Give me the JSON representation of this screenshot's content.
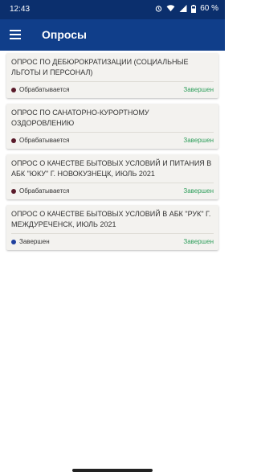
{
  "status_bar": {
    "time": "12:43",
    "battery": "60 %"
  },
  "app_bar": {
    "title": "Опросы",
    "menu_icon": "hamburger-menu-icon"
  },
  "colors": {
    "app_bar": "#103e8a",
    "status_bar": "#0b2f6d",
    "done_green": "#2e9e5b",
    "processing_dot": "#5a1a2a",
    "done_dot": "#1f3f9e"
  },
  "surveys": [
    {
      "title": "ОПРОС ПО ДЕБЮРОКРАТИЗАЦИИ (СОЦИАЛЬНЫЕ ЛЬГОТЫ И ПЕРСОНАЛ)",
      "status": "Обрабатывается",
      "result": "Завершен"
    },
    {
      "title": "ОПРОС ПО САНАТОРНО-КУРОРТНОМУ ОЗДОРОВЛЕНИЮ",
      "status": "Обрабатывается",
      "result": "Завершен"
    },
    {
      "title": "ОПРОС О КАЧЕСТВЕ БЫТОВЫХ УСЛОВИЙ И ПИТАНИЯ В АБК \"ЮКУ\" Г. НОВОКУЗНЕЦК, ИЮЛЬ 2021",
      "status": "Обрабатывается",
      "result": "Завершен"
    },
    {
      "title": "ОПРОС О КАЧЕСТВЕ БЫТОВЫХ УСЛОВИЙ В АБК \"РУК\" Г. МЕЖДУРЕЧЕНСК, ИЮЛЬ 2021",
      "status": "Завершен",
      "result": "Завершен"
    }
  ]
}
